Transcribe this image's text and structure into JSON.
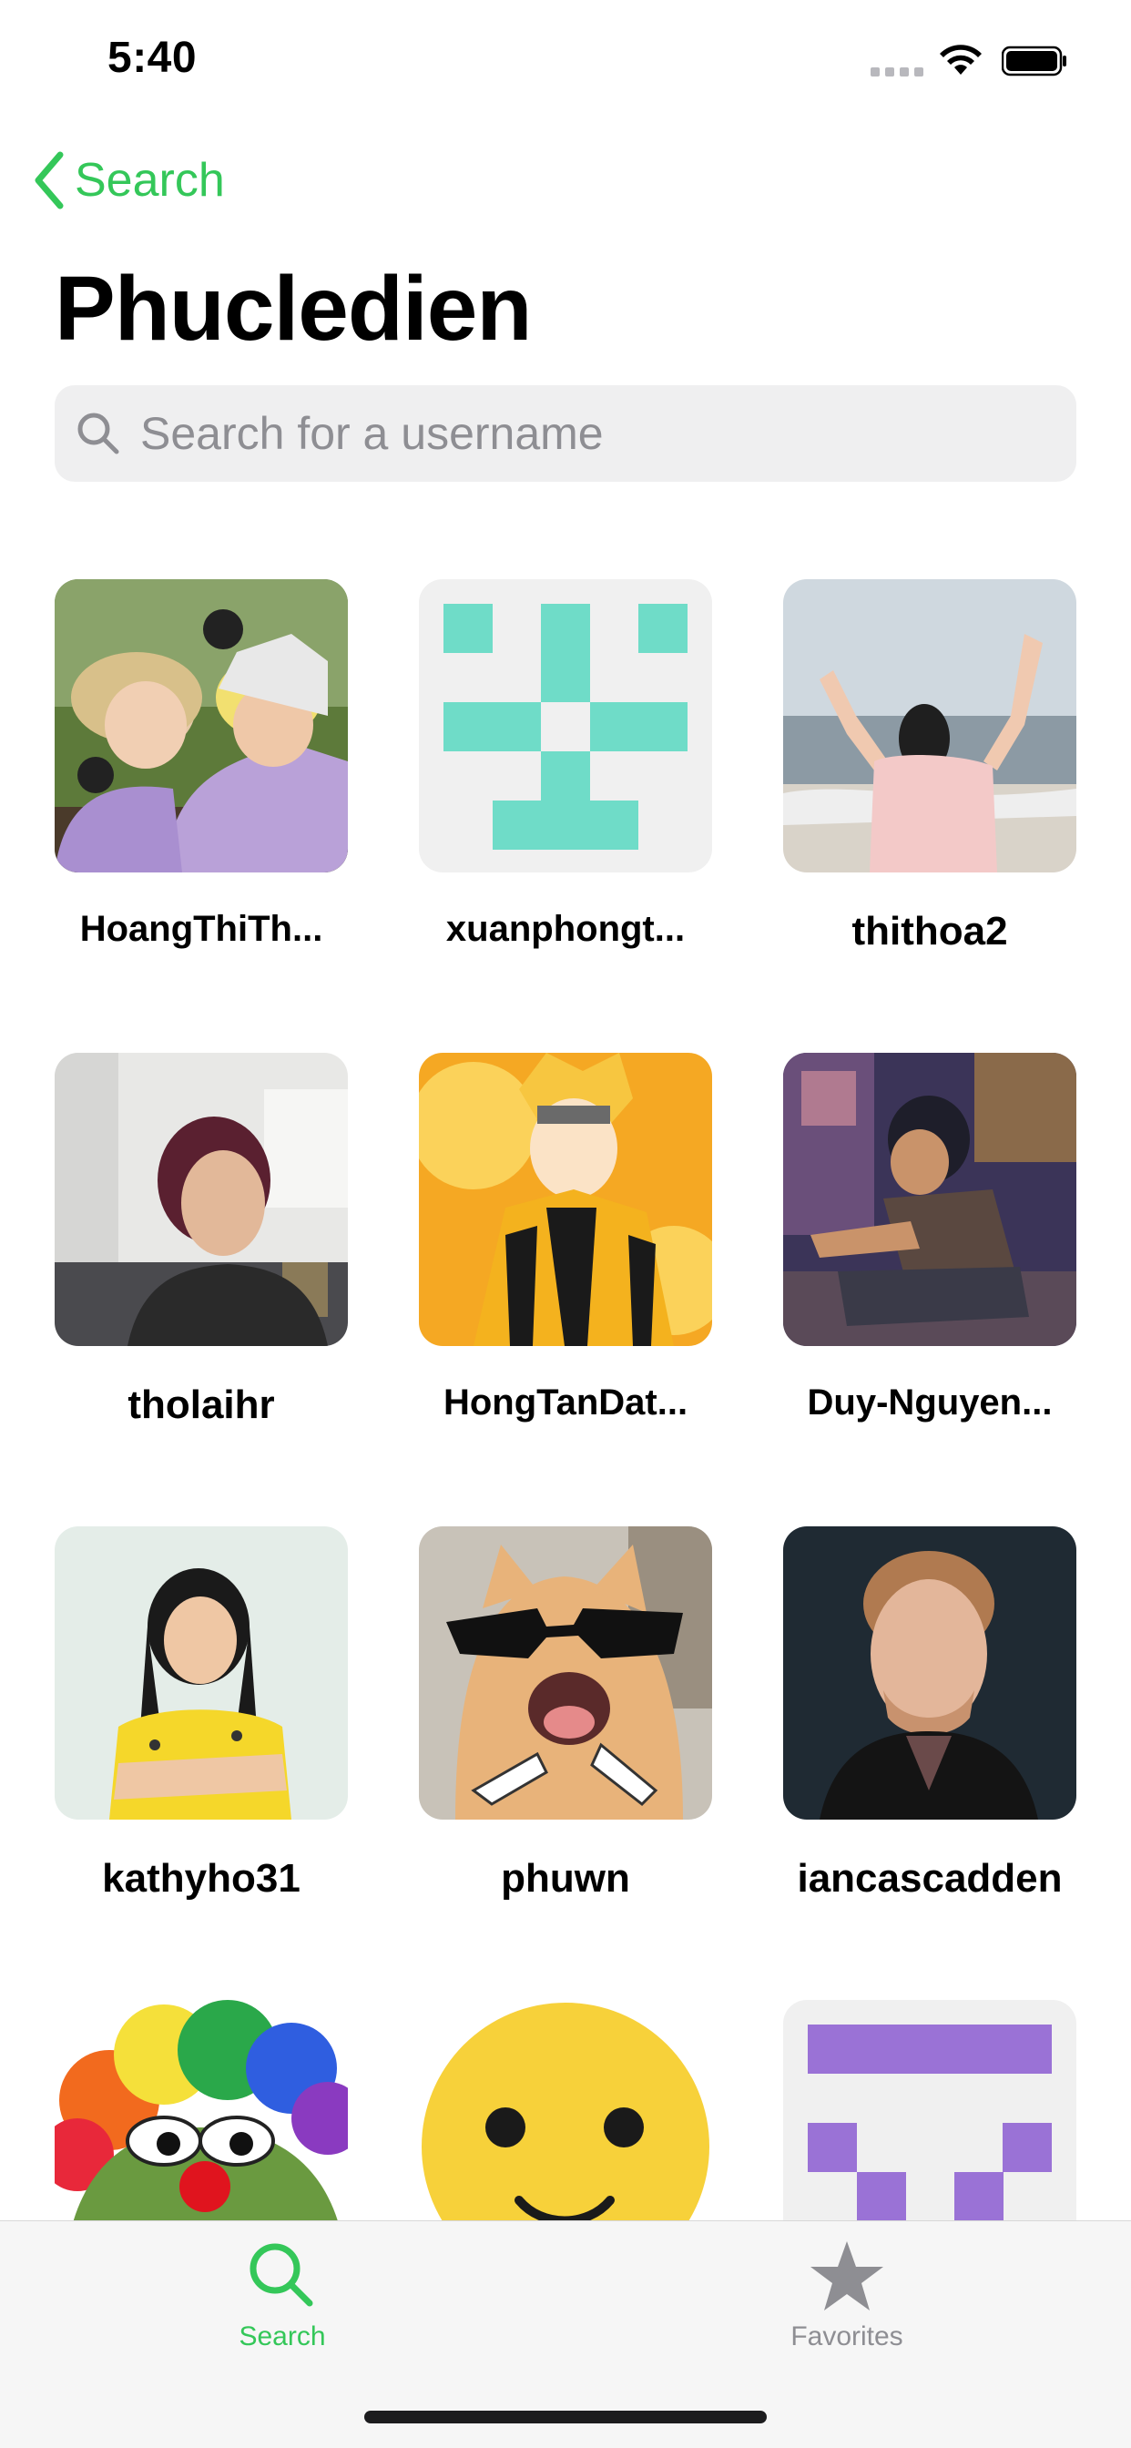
{
  "status_bar": {
    "time": "5:40"
  },
  "nav": {
    "back_label": "Search"
  },
  "page": {
    "title": "Phucledien"
  },
  "search": {
    "placeholder": "Search for a username",
    "value": ""
  },
  "users": [
    {
      "username": "HoangThiTh...",
      "avatar": "photo-two-women-helmets"
    },
    {
      "username": "xuanphongt...",
      "avatar": "identicon-teal"
    },
    {
      "username": "thithoa2",
      "avatar": "photo-beach"
    },
    {
      "username": "tholaihr",
      "avatar": "photo-office-woman"
    },
    {
      "username": "HongTanDat...",
      "avatar": "anime-orange"
    },
    {
      "username": "Duy-Nguyen...",
      "avatar": "photo-man-sitting"
    },
    {
      "username": "kathyho31",
      "avatar": "photo-woman-yellow"
    },
    {
      "username": "phuwn",
      "avatar": "cat-sunglasses"
    },
    {
      "username": "iancascadden",
      "avatar": "photo-man-smiling"
    },
    {
      "username": "",
      "avatar": "clown-frog"
    },
    {
      "username": "",
      "avatar": "smiley-face"
    },
    {
      "username": "",
      "avatar": "identicon-purple"
    }
  ],
  "tabs": [
    {
      "label": "Search",
      "icon": "search-icon",
      "active": true
    },
    {
      "label": "Favorites",
      "icon": "star-icon",
      "active": false
    }
  ],
  "colors": {
    "accent": "#34c759",
    "inactive": "#8e8e93",
    "teal": "#6fdcc8",
    "purple": "#9a72d6"
  }
}
